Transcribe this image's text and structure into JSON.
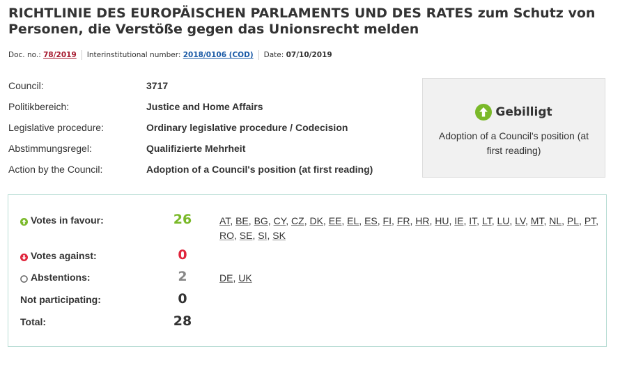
{
  "title": "RICHTLINIE DES EUROPÄISCHEN PARLAMENTS UND DES RATES zum Schutz von Personen, die Verstöße gegen das Unionsrecht melden",
  "meta": {
    "doc_label": "Doc. no.:",
    "doc_value": "78/2019",
    "inter_label": "Interinstitutional number:",
    "inter_value": "2018/0106 (COD)",
    "date_label": "Date:",
    "date_value": "07/10/2019"
  },
  "info": [
    {
      "label": "Council:",
      "value": "3717"
    },
    {
      "label": "Politikbereich:",
      "value": "Justice and Home Affairs"
    },
    {
      "label": "Legislative procedure:",
      "value": "Ordinary legislative procedure / Codecision"
    },
    {
      "label": "Abstimmungsregel:",
      "value": "Qualifizierte Mehrheit"
    },
    {
      "label": "Action by the Council:",
      "value": "Adoption of a Council's position (at first reading)"
    }
  ],
  "status": {
    "title": "Gebilligt",
    "description": "Adoption of a Council's position (at first reading)",
    "accent": "#7ab929"
  },
  "votes": {
    "favour": {
      "label": "Votes in favour:",
      "count": "26",
      "countries": [
        "AT",
        "BE",
        "BG",
        "CY",
        "CZ",
        "DK",
        "EE",
        "EL",
        "ES",
        "FI",
        "FR",
        "HR",
        "HU",
        "IE",
        "IT",
        "LT",
        "LU",
        "LV",
        "MT",
        "NL",
        "PL",
        "PT",
        "RO",
        "SE",
        "SI",
        "SK"
      ]
    },
    "against": {
      "label": "Votes against:",
      "count": "0",
      "countries": []
    },
    "abstentions": {
      "label": "Abstentions:",
      "count": "2",
      "countries": [
        "DE",
        "UK"
      ]
    },
    "not_participating": {
      "label": "Not participating:",
      "count": "0"
    },
    "total": {
      "label": "Total:",
      "count": "28"
    }
  }
}
